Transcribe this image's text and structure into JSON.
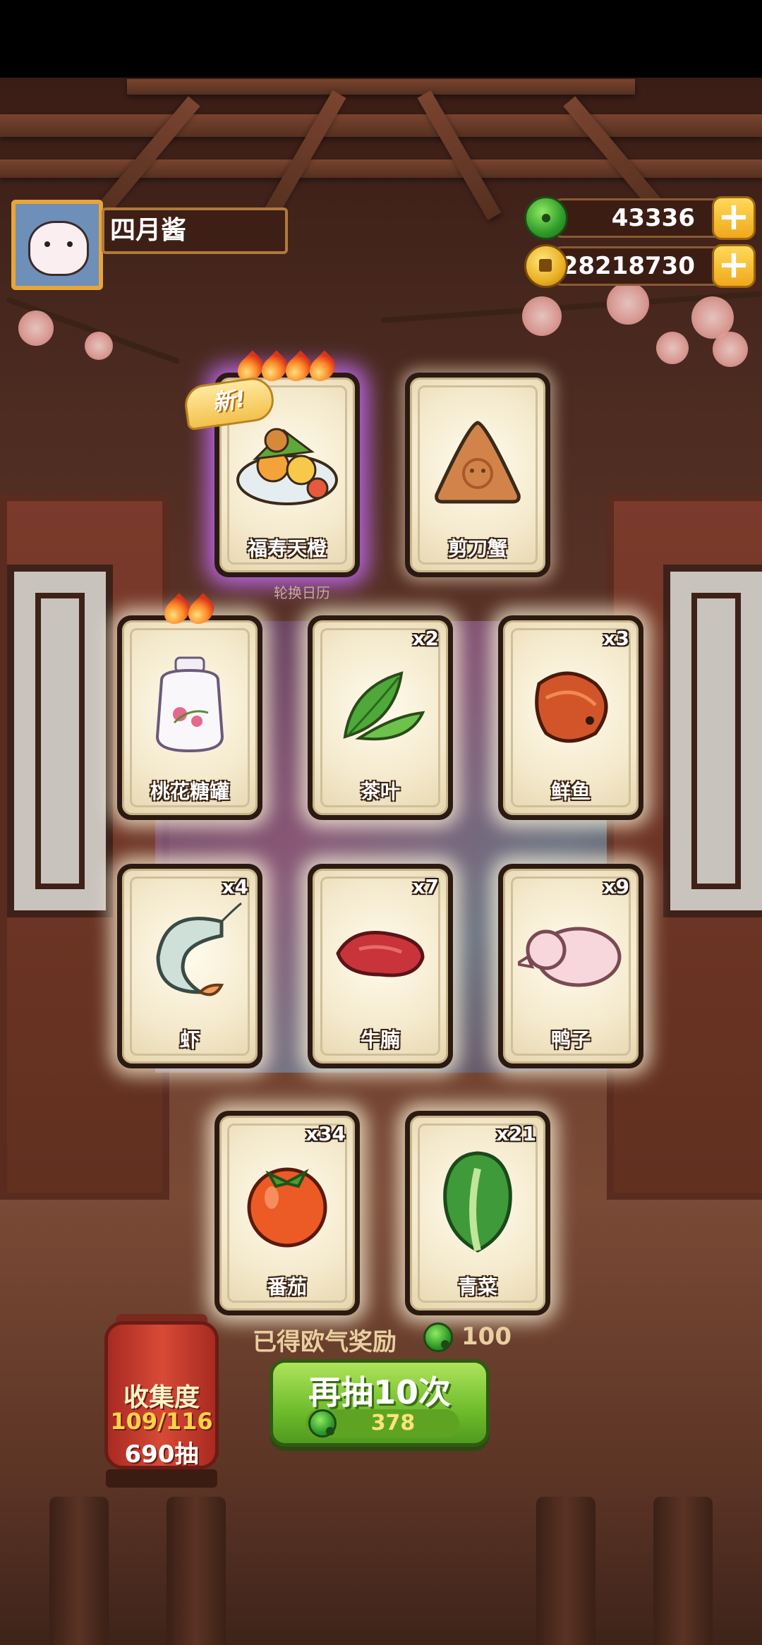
{
  "player": {
    "name": "四月酱",
    "avatar_icon": "pig-avatar-icon"
  },
  "resources": {
    "jade": {
      "icon": "jade-icon",
      "value": "43336",
      "add_label": "+"
    },
    "coins": {
      "icon": "coin-icon",
      "value": "28218730",
      "add_label": "+"
    }
  },
  "new_tag": "新!",
  "calendar_hint": "轮换日历",
  "cards": [
    {
      "name": "福寿天橙",
      "count": "",
      "flames": 4,
      "is_new": true,
      "glow": "purple",
      "art": "dish-icon"
    },
    {
      "name": "剪刀蟹",
      "count": "",
      "flames": 0,
      "is_new": false,
      "glow": "plain",
      "art": "crab-cookie-icon"
    },
    {
      "name": "桃花糖罐",
      "count": "",
      "flames": 2,
      "is_new": false,
      "glow": "gold",
      "art": "candy-jar-icon"
    },
    {
      "name": "茶叶",
      "count": "x2",
      "flames": 0,
      "is_new": false,
      "glow": "gold",
      "art": "tea-leaf-icon"
    },
    {
      "name": "鲜鱼",
      "count": "x3",
      "flames": 0,
      "is_new": false,
      "glow": "gold",
      "art": "fish-icon"
    },
    {
      "name": "虾",
      "count": "x4",
      "flames": 0,
      "is_new": false,
      "glow": "gold",
      "art": "shrimp-icon"
    },
    {
      "name": "牛腩",
      "count": "x7",
      "flames": 0,
      "is_new": false,
      "glow": "gold",
      "art": "beef-icon"
    },
    {
      "name": "鸭子",
      "count": "x9",
      "flames": 0,
      "is_new": false,
      "glow": "gold",
      "art": "duck-icon"
    },
    {
      "name": "番茄",
      "count": "x34",
      "flames": 0,
      "is_new": false,
      "glow": "gold",
      "art": "tomato-icon"
    },
    {
      "name": "青菜",
      "count": "x21",
      "flames": 0,
      "is_new": false,
      "glow": "gold",
      "art": "bok-choy-icon"
    }
  ],
  "reward": {
    "label": "已得欧气奖励",
    "value": "100"
  },
  "collection": {
    "title": "收集度",
    "progress": "109/116",
    "draws": "690抽"
  },
  "draw_button": {
    "label": "再抽10次",
    "cost": "378"
  },
  "colors": {
    "accent_green": "#6fbc2c",
    "frame_gold": "#e8a63a",
    "lantern_red": "#d84a36"
  }
}
